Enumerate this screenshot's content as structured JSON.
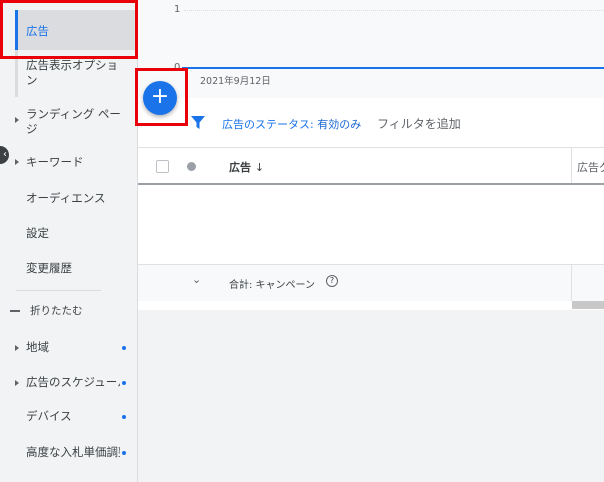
{
  "sidebar": {
    "items": [
      {
        "label": "広告",
        "selected": true
      },
      {
        "label": "広告表示オプション"
      },
      {
        "label": "ランディング ページ"
      },
      {
        "label": "キーワード"
      },
      {
        "label": "オーディエンス"
      },
      {
        "label": "設定"
      },
      {
        "label": "変更履歴"
      }
    ],
    "collapse_label": "折りたたむ",
    "sub_items": [
      {
        "label": "地域"
      },
      {
        "label": "広告のスケジュール"
      },
      {
        "label": "デバイス"
      },
      {
        "label": "高度な入札単価調整"
      }
    ]
  },
  "chart": {
    "y_tick_top": "1",
    "y_tick_bottom": "0",
    "date_label": "2021年9月12日",
    "line_color": "#1a73e8"
  },
  "filter": {
    "status_prefix": "広告のステータス:",
    "status_value": "有効のみ",
    "add_filter": "フィルタを追加"
  },
  "table": {
    "columns": [
      "広告",
      "広告グ"
    ],
    "sort": "↓",
    "total_label": "合計: キャンペーン"
  },
  "colors": {
    "accent": "#1a73e8",
    "highlight": "#e8000b"
  }
}
